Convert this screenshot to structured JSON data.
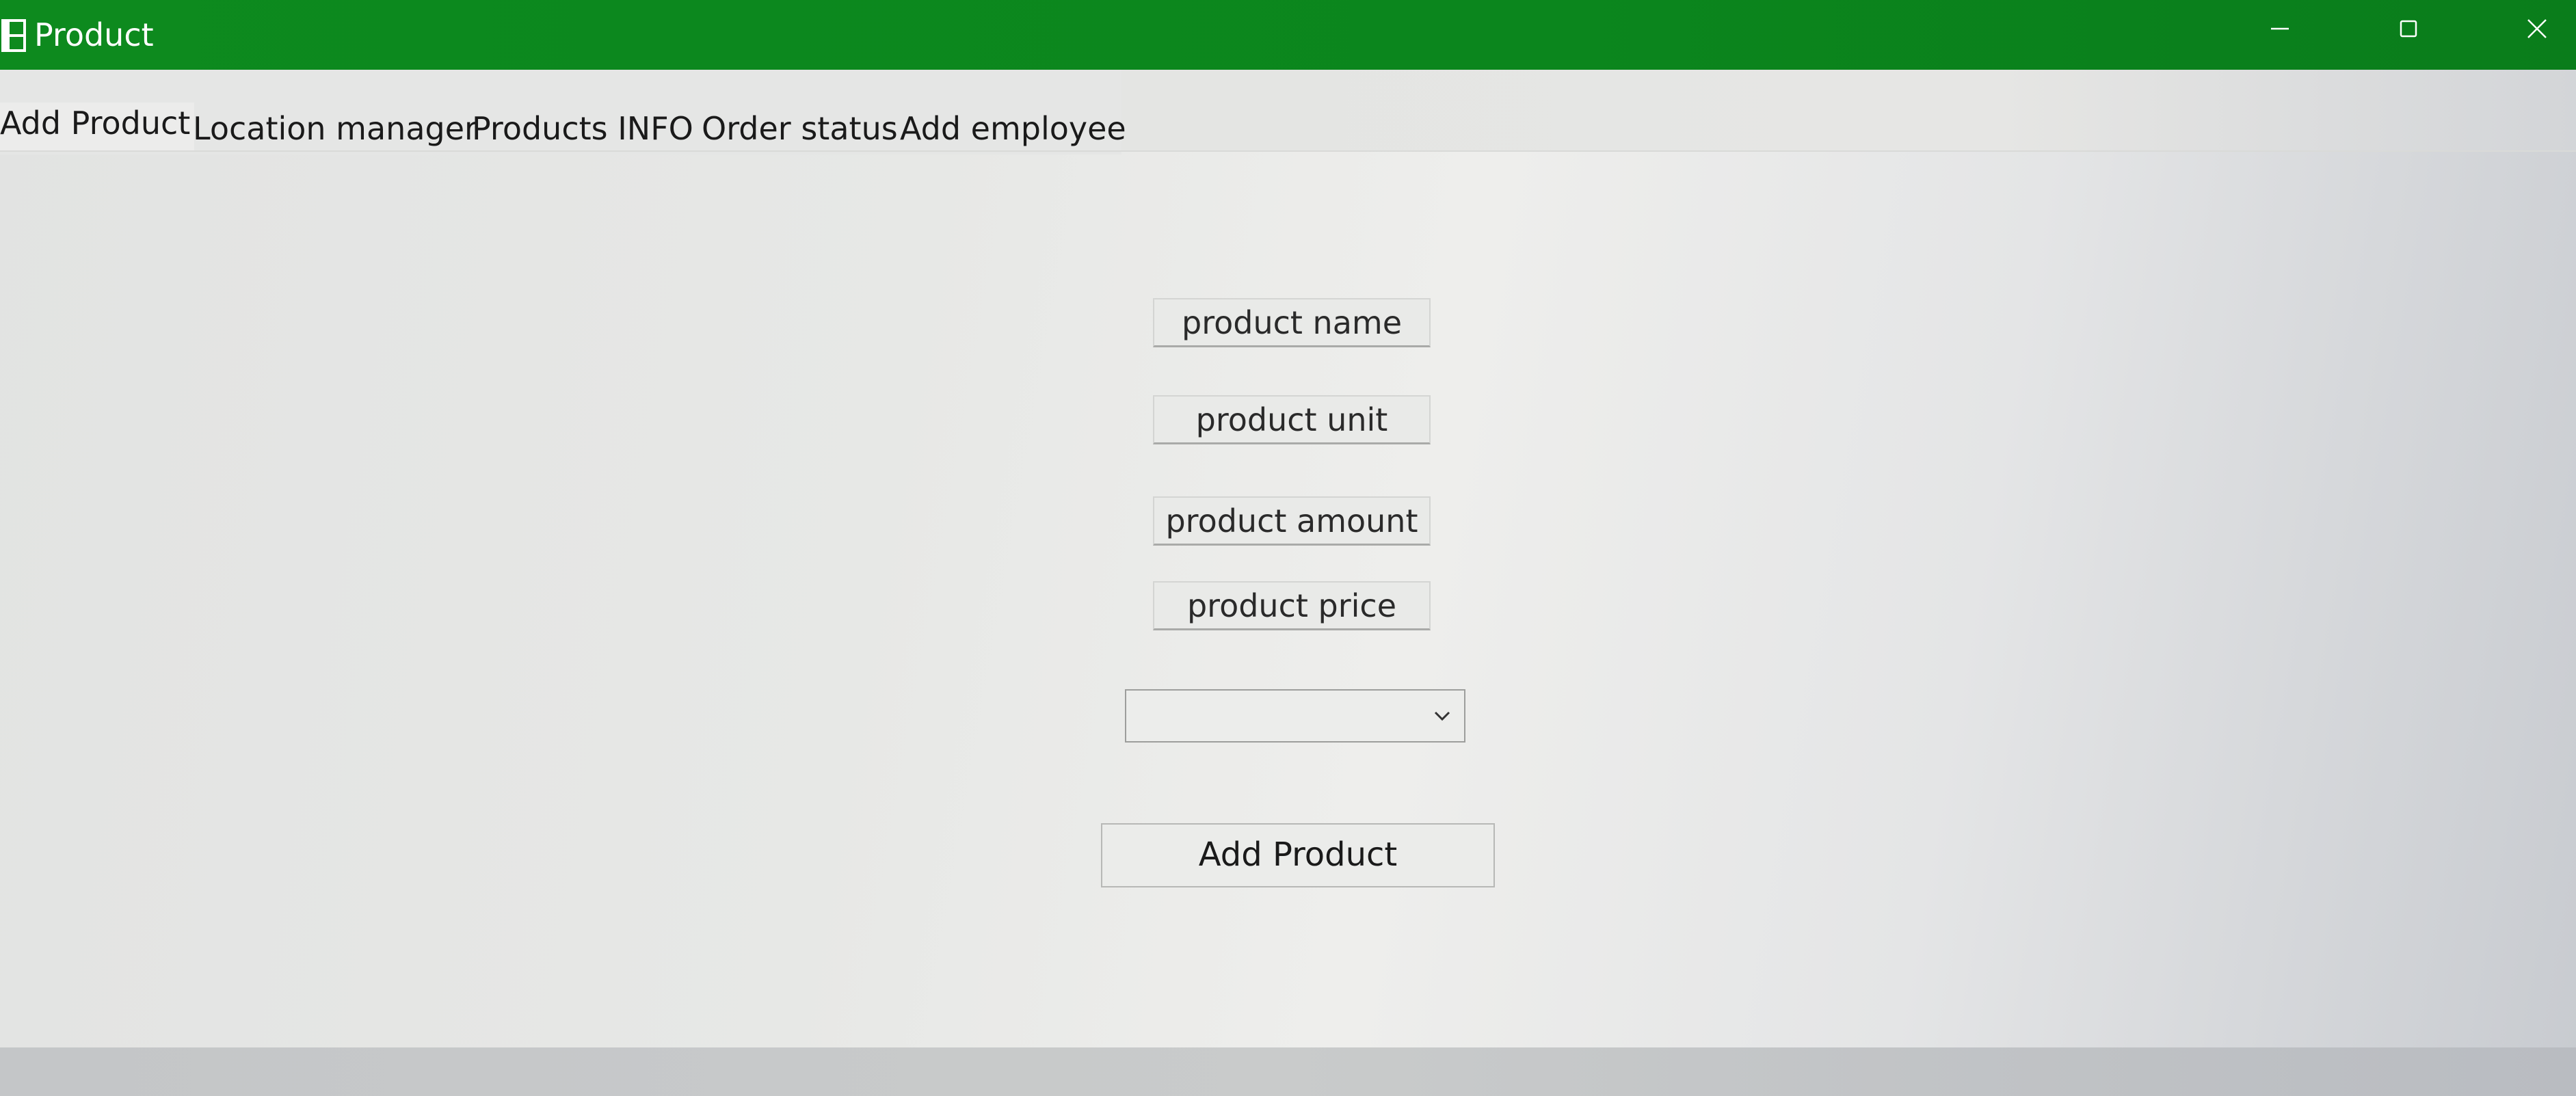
{
  "window": {
    "title": "Product",
    "accent_color": "#0b861d",
    "icons": {
      "app": "app-window-icon",
      "minimize": "minimize-icon",
      "maximize": "maximize-icon",
      "close": "close-icon"
    }
  },
  "tabs": [
    {
      "label": "Add Product",
      "active": true
    },
    {
      "label": "Location manager",
      "active": false
    },
    {
      "label": "Products INFO",
      "active": false
    },
    {
      "label": "Order status",
      "active": false
    },
    {
      "label": "Add employee",
      "active": false
    }
  ],
  "form": {
    "fields": [
      {
        "label": "product name"
      },
      {
        "label": "product unit"
      },
      {
        "label": "product amount"
      },
      {
        "label": "product price"
      }
    ],
    "combo": {
      "selected_value": "",
      "icon": "chevron-down-icon"
    },
    "submit_label": "Add Product"
  }
}
